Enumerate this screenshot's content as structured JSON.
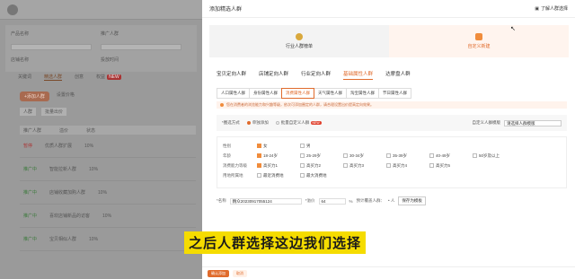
{
  "bg": {
    "filters": [
      "产品名称",
      "推广人群",
      "店铺名称",
      "投放时间"
    ],
    "tabs": [
      "关键词",
      "精选人群",
      "创意",
      "权益"
    ],
    "tab_badge": "NEW",
    "btn_primary": "+添加人群",
    "btn_secondary": "设置价格",
    "sub": [
      "人群",
      "批量出价"
    ],
    "thead": [
      "推广人群",
      "溢价",
      "状态"
    ],
    "rows": [
      {
        "status": "暂停",
        "name": "优质人群扩展",
        "price": "10%"
      },
      {
        "status": "推广中",
        "name": "智能拉新人群",
        "price": "10%"
      },
      {
        "status": "推广中",
        "name": "店铺收藏加购人群",
        "price": "10%"
      },
      {
        "status": "推广中",
        "name": "喜欢店铺新品的访客",
        "price": "10%"
      },
      {
        "status": "推广中",
        "name": "宝贝相似人群",
        "price": "10%"
      }
    ]
  },
  "panel": {
    "title": "添加精选人群",
    "help": "了解人群选择",
    "cards": [
      "行业人群榜单",
      "自定义新建"
    ],
    "tabs1": [
      "宝贝定向人群",
      "店铺定向人群",
      "行业定向人群",
      "基础属性人群",
      "达摩盘人群"
    ],
    "tabs2": [
      "人口属性人群",
      "身份属性人群",
      "消费属性人群",
      "天气属性人群",
      "淘宝属性人群",
      "节日属性人群"
    ],
    "notice": "您在消费者的浏览能力和兴趣等级，依次可添加圈定的人群，请合理设置出价提高定向效果。",
    "choose_label": "*圈选方式",
    "choose_opt1": "单独添加",
    "choose_opt2": "批量自定义人群",
    "choose_new": "NEW",
    "choose_right": "自定义人群模版",
    "choose_select": "请选择人群模版",
    "rows": [
      {
        "label": "性别",
        "opts": [
          "女",
          "男"
        ],
        "checked": [
          0
        ]
      },
      {
        "label": "年龄",
        "opts": [
          "18-24岁",
          "25-29岁",
          "30-34岁",
          "35-39岁",
          "40-49岁",
          "50岁及以上"
        ],
        "checked": [
          0
        ]
      },
      {
        "label": "消费能力等级",
        "opts": [
          "高买力1",
          "高买力2",
          "高买力3",
          "高买力4",
          "高买力5"
        ],
        "checked": [
          0
        ]
      },
      {
        "label": "用地所属地",
        "opts": [
          "最近消费地",
          "最大消费地"
        ],
        "checked": []
      }
    ],
    "name_label": "*名称",
    "name_value": "精众20230917055124",
    "price_label": "*溢价",
    "price_value": "64",
    "pct": "%",
    "est_label": "预计覆盖人群：",
    "est_value": "• 人",
    "tpl_btn": "保存为模板",
    "ok": "确认添加",
    "cancel": "取消"
  },
  "subtitle": "之后人群选择这边我们选择"
}
